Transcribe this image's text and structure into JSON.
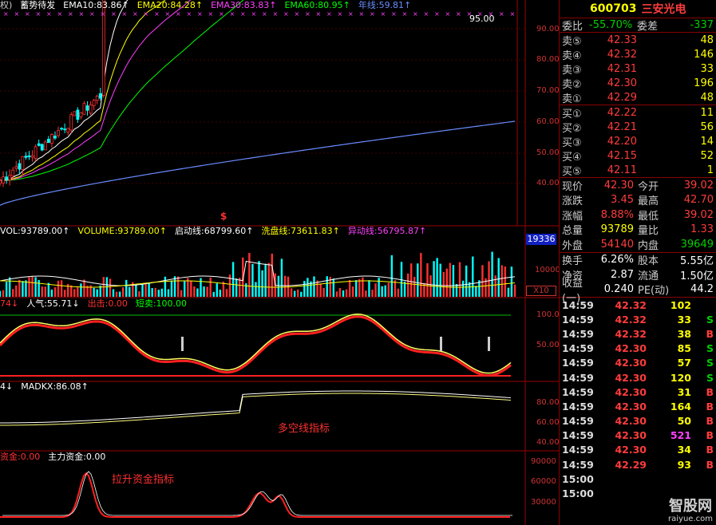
{
  "main_chart": {
    "indicators": [
      {
        "label": "权)",
        "color": "#cccccc"
      },
      {
        "label": "蓄势待发",
        "color": "#ffffff"
      },
      {
        "label": "EMA10:83.86↑",
        "color": "#ffffff"
      },
      {
        "label": "EMA20:84.28↑",
        "color": "#ffff00"
      },
      {
        "label": "EMA30:83.83↑",
        "color": "#ff40ff"
      },
      {
        "label": "EMA60:80.95↑",
        "color": "#00ff00"
      },
      {
        "label": "年线:59.81↑",
        "color": "#6a8cff"
      }
    ],
    "peak_label": "95.00",
    "y_ticks": [
      "90.00",
      "80.00",
      "70.00",
      "60.00",
      "50.00",
      "40.00"
    ],
    "year_line_range": [
      33,
      60
    ]
  },
  "volume_panel": {
    "indicators": [
      {
        "label": "VOL:93789.00↑",
        "color": "#ffffff"
      },
      {
        "label": "VOLUME:93789.00↑",
        "color": "#ffff00"
      },
      {
        "label": "启动线:68799.60↑",
        "color": "#ffffff"
      },
      {
        "label": "洗盘线:73611.83↑",
        "color": "#ffff00"
      },
      {
        "label": "异动线:56795.87↑",
        "color": "#ff40ff"
      }
    ],
    "dollar_mark": "$",
    "box_label": "19336",
    "y_tick": "10000",
    "unit": "X10"
  },
  "sentiment_panel": {
    "indicators": [
      {
        "label": "74↓",
        "color": "#ff3030"
      },
      {
        "label": "人气:55.71↓",
        "color": "#ffffff"
      },
      {
        "label": "出击:0.00",
        "color": "#ff3030"
      },
      {
        "label": "短卖:100.00",
        "color": "#00ff00"
      }
    ],
    "y_ticks": [
      "100.0",
      "50.00"
    ]
  },
  "madkx_panel": {
    "indicators": [
      {
        "label": "4↓",
        "color": "#ffffff"
      },
      {
        "label": "MADKX:86.08↑",
        "color": "#ffffff"
      }
    ],
    "annotation": "多空线指标",
    "y_ticks": [
      "80.00",
      "60.00",
      "40.00"
    ]
  },
  "capital_panel": {
    "indicators": [
      {
        "label": "资金:0.00",
        "color": "#ff3030"
      },
      {
        "label": "主力资金:0.00",
        "color": "#ffffff"
      }
    ],
    "annotation": "拉升资金指标",
    "y_ticks": [
      "90000",
      "60000",
      "30000"
    ]
  },
  "quote": {
    "code": "600703",
    "name": "三安光电",
    "weibi_label": "委比",
    "weibi_value": "-55.70%",
    "weicha_label": "委差",
    "weicha_value": "-337",
    "sell": [
      {
        "label": "卖⑤",
        "price": "42.33",
        "vol": "48"
      },
      {
        "label": "卖④",
        "price": "42.32",
        "vol": "146"
      },
      {
        "label": "卖③",
        "price": "42.31",
        "vol": "33"
      },
      {
        "label": "卖②",
        "price": "42.30",
        "vol": "196"
      },
      {
        "label": "卖①",
        "price": "42.29",
        "vol": "48"
      }
    ],
    "buy": [
      {
        "label": "买①",
        "price": "42.22",
        "vol": "11"
      },
      {
        "label": "买②",
        "price": "42.21",
        "vol": "56"
      },
      {
        "label": "买③",
        "price": "42.20",
        "vol": "14"
      },
      {
        "label": "买④",
        "price": "42.15",
        "vol": "52"
      },
      {
        "label": "买⑤",
        "price": "42.11",
        "vol": "1"
      }
    ],
    "stats": [
      {
        "l1": "现价",
        "v1": "42.30",
        "c1": "red",
        "l2": "今开",
        "v2": "39.02",
        "c2": "red"
      },
      {
        "l1": "涨跌",
        "v1": "3.45",
        "c1": "red",
        "l2": "最高",
        "v2": "42.70",
        "c2": "red"
      },
      {
        "l1": "涨幅",
        "v1": "8.88%",
        "c1": "red",
        "l2": "最低",
        "v2": "39.02",
        "c2": "red"
      },
      {
        "l1": "总量",
        "v1": "93789",
        "c1": "yellow",
        "l2": "量比",
        "v2": "1.33",
        "c2": "red"
      },
      {
        "l1": "外盘",
        "v1": "54140",
        "c1": "red",
        "l2": "内盘",
        "v2": "39649",
        "c2": "green"
      }
    ],
    "fundamentals": [
      {
        "l1": "换手",
        "v1": "6.26%",
        "l2": "股本",
        "v2": "5.55亿"
      },
      {
        "l1": "净资",
        "v1": "2.87",
        "l2": "流通",
        "v2": "1.50亿"
      },
      {
        "l1": "收益(一)",
        "v1": "0.240",
        "l2": "PE(动)",
        "v2": "44.2"
      }
    ],
    "ticks": [
      {
        "time": "14:59",
        "price": "42.32",
        "pc": "red",
        "vol": "102",
        "vc": "yellow",
        "side": "",
        "sc": "red"
      },
      {
        "time": "14:59",
        "price": "42.32",
        "pc": "red",
        "vol": "33",
        "vc": "yellow",
        "side": "S",
        "sc": "green"
      },
      {
        "time": "14:59",
        "price": "42.32",
        "pc": "red",
        "vol": "38",
        "vc": "yellow",
        "side": "B",
        "sc": "red"
      },
      {
        "time": "14:59",
        "price": "42.30",
        "pc": "red",
        "vol": "85",
        "vc": "yellow",
        "side": "S",
        "sc": "green"
      },
      {
        "time": "14:59",
        "price": "42.30",
        "pc": "red",
        "vol": "57",
        "vc": "yellow",
        "side": "S",
        "sc": "green"
      },
      {
        "time": "14:59",
        "price": "42.30",
        "pc": "red",
        "vol": "120",
        "vc": "yellow",
        "side": "S",
        "sc": "green"
      },
      {
        "time": "14:59",
        "price": "42.30",
        "pc": "red",
        "vol": "31",
        "vc": "yellow",
        "side": "B",
        "sc": "red"
      },
      {
        "time": "14:59",
        "price": "42.30",
        "pc": "red",
        "vol": "164",
        "vc": "yellow",
        "side": "B",
        "sc": "red"
      },
      {
        "time": "14:59",
        "price": "42.30",
        "pc": "red",
        "vol": "50",
        "vc": "yellow",
        "side": "B",
        "sc": "red"
      },
      {
        "time": "14:59",
        "price": "42.30",
        "pc": "red",
        "vol": "521",
        "vc": "mag",
        "side": "B",
        "sc": "red"
      },
      {
        "time": "14:59",
        "price": "42.30",
        "pc": "red",
        "vol": "34",
        "vc": "yellow",
        "side": "B",
        "sc": "red"
      },
      {
        "time": "14:59",
        "price": "42.29",
        "pc": "red",
        "vol": "93",
        "vc": "yellow",
        "side": "B",
        "sc": "red"
      },
      {
        "time": "15:00",
        "price": "",
        "pc": "red",
        "vol": "",
        "vc": "yellow",
        "side": "",
        "sc": "red"
      },
      {
        "time": "15:00",
        "price": "",
        "pc": "red",
        "vol": "",
        "vc": "yellow",
        "side": "",
        "sc": "red"
      }
    ]
  },
  "watermark": {
    "brand": "智股网",
    "url": "raiyue.com"
  }
}
